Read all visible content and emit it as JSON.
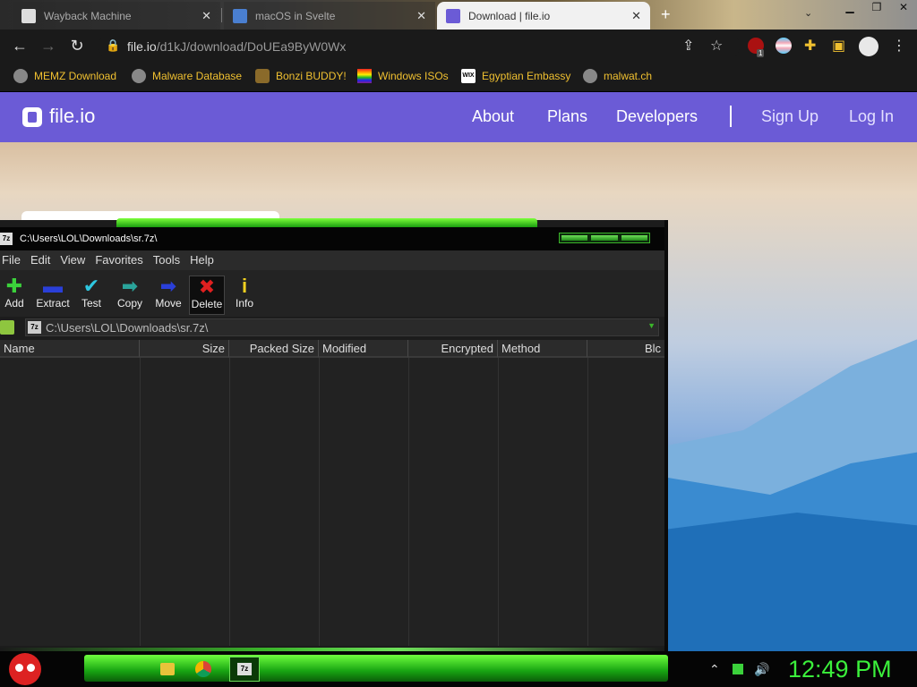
{
  "browser": {
    "tabs": [
      {
        "title": "Wayback Machine",
        "active": false
      },
      {
        "title": "macOS in Svelte",
        "active": false
      },
      {
        "title": "Download | file.io",
        "active": true
      }
    ],
    "url_host": "file.io",
    "url_path": "/d1kJ/download/DoUEa9ByW0Wx",
    "extension_badge": "1",
    "bookmarks": [
      {
        "label": "MEMZ Download"
      },
      {
        "label": "Malware Database"
      },
      {
        "label": "Bonzi BUDDY!"
      },
      {
        "label": "Windows ISOs"
      },
      {
        "label": "Egyptian Embassy"
      },
      {
        "label": "malwat.ch"
      }
    ]
  },
  "site": {
    "logo": "file.io",
    "nav": {
      "about": "About",
      "plans": "Plans",
      "developers": "Developers",
      "sign_up": "Sign Up",
      "log_in": "Log In"
    },
    "brand_color": "#6b5bd6"
  },
  "sevenzip": {
    "title": "C:\\Users\\LOL\\Downloads\\sr.7z\\",
    "app_icon": "7z",
    "menu": [
      "File",
      "Edit",
      "View",
      "Favorites",
      "Tools",
      "Help"
    ],
    "toolbar": {
      "add": "Add",
      "extract": "Extract",
      "test": "Test",
      "copy": "Copy",
      "move": "Move",
      "delete": "Delete",
      "info": "Info"
    },
    "address": "C:\\Users\\LOL\\Downloads\\sr.7z\\",
    "columns": {
      "name": "Name",
      "size": "Size",
      "packed_size": "Packed Size",
      "modified": "Modified",
      "encrypted": "Encrypted",
      "method": "Method",
      "block": "Blc"
    }
  },
  "taskbar": {
    "clock": "12:49 PM",
    "active_app_icon": "7z",
    "accent_color": "#3bb52a"
  }
}
